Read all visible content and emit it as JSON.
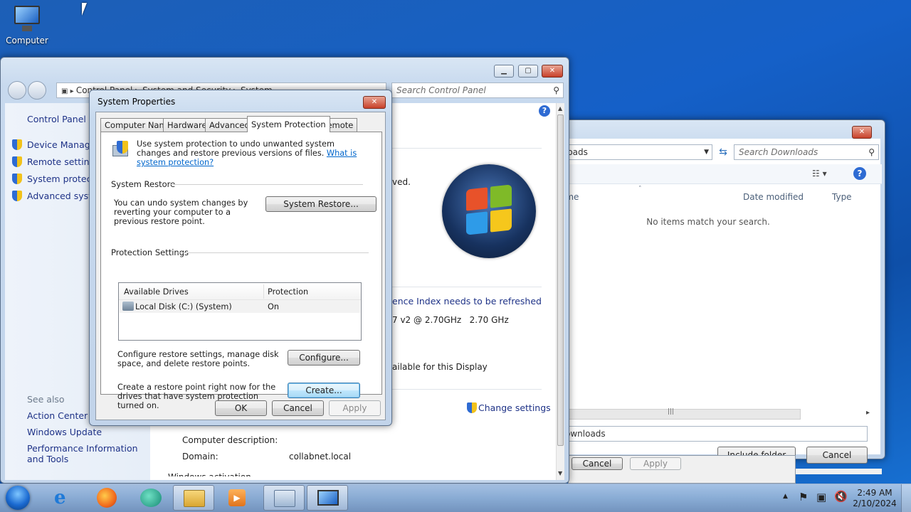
{
  "desktop": {
    "icon_label": "Computer"
  },
  "explorer": {
    "address_text": "loads",
    "search_placeholder": "Search Downloads",
    "columns": {
      "name": "ame",
      "date": "Date modified",
      "type": "Type"
    },
    "empty_message": "No items match your search.",
    "folder_field": "ownloads",
    "include_label": "Include folder",
    "cancel_label": "Cancel",
    "back_cancel_label": "Cancel",
    "back_apply_label": "Apply"
  },
  "control_panel": {
    "breadcrumb": [
      "Control Panel",
      "System and Security",
      "System"
    ],
    "search_placeholder": "Search Control Panel",
    "sidebar": {
      "home": "Control Panel Ho",
      "items": [
        "Device Manager",
        "Remote settings",
        "System protectio",
        "Advanced system"
      ],
      "see_also": "See also",
      "see_also_items": [
        "Action Center",
        "Windows Update",
        "Performance Information and Tools"
      ]
    },
    "main": {
      "reserved_tail": "ved.",
      "index_link": "ence Index needs to be refreshed",
      "processor": "7 v2 @ 2.70GHz   2.70 GHz",
      "pen_touch": "ailable for this Display",
      "change_settings": "Change settings",
      "computer_description_label": "Computer description:",
      "domain_label": "Domain:",
      "domain_value": "collabnet.local",
      "cutoff": "Windows activation"
    }
  },
  "dialog": {
    "title": "System Properties",
    "tabs": [
      "Computer Name",
      "Hardware",
      "Advanced",
      "System Protection",
      "Remote"
    ],
    "intro_text": "Use system protection to undo unwanted system changes and restore previous versions of files.",
    "intro_link": "What is system protection?",
    "restore_group": "System Restore",
    "restore_text": "You can undo system changes by reverting your computer to a previous restore point.",
    "restore_button": "System Restore...",
    "protection_group": "Protection Settings",
    "drives_header": [
      "Available Drives",
      "Protection"
    ],
    "drives": [
      {
        "name": "Local Disk (C:) (System)",
        "protection": "On"
      }
    ],
    "configure_text": "Configure restore settings, manage disk space, and delete restore points.",
    "configure_button": "Configure...",
    "create_text": "Create a restore point right now for the drives that have system protection turned on.",
    "create_button": "Create...",
    "ok": "OK",
    "cancel": "Cancel",
    "apply": "Apply"
  },
  "taskbar": {
    "time": "2:49 AM",
    "date": "2/10/2024"
  }
}
